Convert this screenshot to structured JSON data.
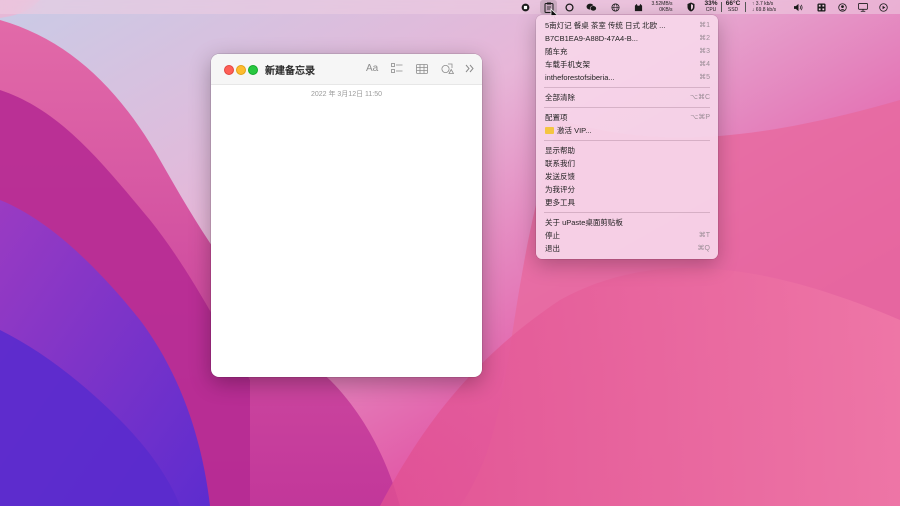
{
  "menubar": {
    "network_upload": "3.52MB/s",
    "network_download": "0KB/s",
    "cpu_percent": "33%",
    "cpu_label": "CPU",
    "temp": "66°C",
    "temp_sub": "SSD",
    "net2_up": "↑ 3.7 kb/s",
    "net2_down": "↓ 69.8 kb/s"
  },
  "notes": {
    "title": "新建备忘录",
    "date": "2022 年 3月12日 11:50",
    "format_label": "Aa"
  },
  "dropdown": {
    "clips": [
      {
        "label": "5南灯记 餐桌 茶室 传统 日式 北欧 ...",
        "shortcut": "⌘1"
      },
      {
        "label": "B7CB1EA9-A88D-47A4-B...",
        "shortcut": "⌘2"
      },
      {
        "label": "随车充",
        "shortcut": "⌘3"
      },
      {
        "label": "车载手机支架",
        "shortcut": "⌘4"
      },
      {
        "label": "intheforestofsiberia...",
        "shortcut": "⌘5"
      }
    ],
    "clear_all": {
      "label": "全部清除",
      "shortcut": "⌥⌘C"
    },
    "preferences": {
      "label": "配置项",
      "shortcut": "⌥⌘P"
    },
    "activate_vip": "激活 VIP...",
    "help_items": [
      "显示帮助",
      "联系我们",
      "发送反馈",
      "为我评分",
      "更多工具"
    ],
    "about": "关于 uPaste桌面剪贴板",
    "stop": {
      "label": "停止",
      "shortcut": "⌘T"
    },
    "quit": {
      "label": "退出",
      "shortcut": "⌘Q"
    }
  }
}
